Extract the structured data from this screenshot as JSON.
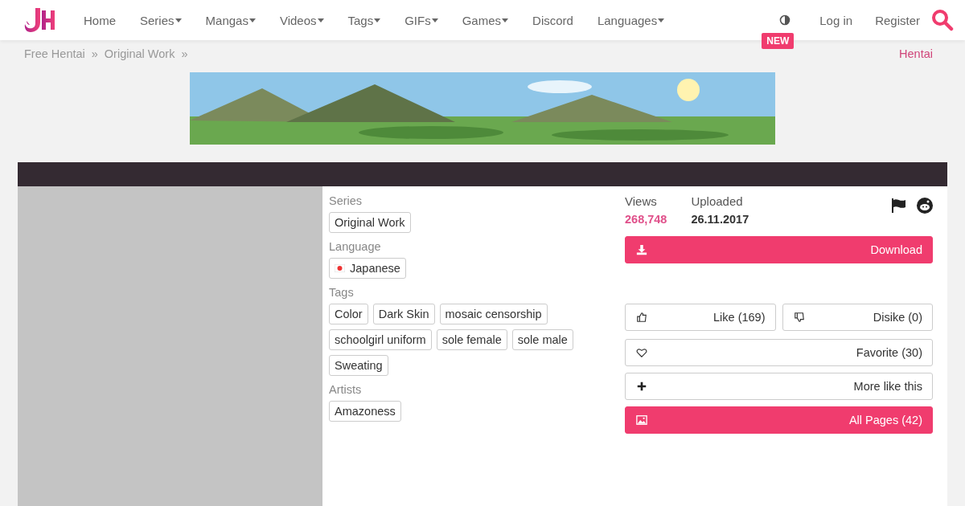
{
  "nav": {
    "items": [
      {
        "label": "Home",
        "dropdown": false
      },
      {
        "label": "Series",
        "dropdown": true
      },
      {
        "label": "Mangas",
        "dropdown": true
      },
      {
        "label": "Videos",
        "dropdown": true
      },
      {
        "label": "Tags",
        "dropdown": true
      },
      {
        "label": "GIFs",
        "dropdown": true
      },
      {
        "label": "Games",
        "dropdown": true
      },
      {
        "label": "Discord",
        "dropdown": false
      },
      {
        "label": "Languages",
        "dropdown": true
      }
    ],
    "theme_badge": "NEW",
    "login": "Log in",
    "register": "Register"
  },
  "breadcrumb": {
    "items": [
      "Free Hentai",
      "Original Work"
    ],
    "separator": "»",
    "right_link": "Hentai"
  },
  "details": {
    "sections": [
      {
        "label": "Series",
        "tags": [
          {
            "text": "Original Work",
            "kind": "plain"
          }
        ]
      },
      {
        "label": "Language",
        "tags": [
          {
            "text": "Japanese",
            "kind": "flag"
          }
        ]
      },
      {
        "label": "Tags",
        "tags": [
          {
            "text": "Color",
            "kind": "plain"
          },
          {
            "text": "Dark Skin",
            "kind": "plain"
          },
          {
            "text": "mosaic censorship",
            "kind": "plain"
          },
          {
            "text": "schoolgirl uniform",
            "kind": "plain"
          },
          {
            "text": "sole female",
            "kind": "plain"
          },
          {
            "text": "sole male",
            "kind": "plain"
          },
          {
            "text": "Sweating",
            "kind": "plain"
          }
        ]
      },
      {
        "label": "Artists",
        "tags": [
          {
            "text": "Amazoness",
            "kind": "plain"
          }
        ]
      }
    ]
  },
  "stats": {
    "views_label": "Views",
    "views": "268,748",
    "uploaded_label": "Uploaded",
    "uploaded": "26.11.2017"
  },
  "actions": [
    {
      "label": "Download",
      "kind": "primary"
    },
    {
      "label": "Like (169)",
      "kind": "outline"
    },
    {
      "label": "Disike (0)",
      "kind": "outline"
    },
    {
      "label": "Favorite (30)",
      "kind": "outline"
    },
    {
      "label": "More like this",
      "kind": "outline"
    },
    {
      "label": "All Pages (42)",
      "kind": "primary"
    }
  ]
}
